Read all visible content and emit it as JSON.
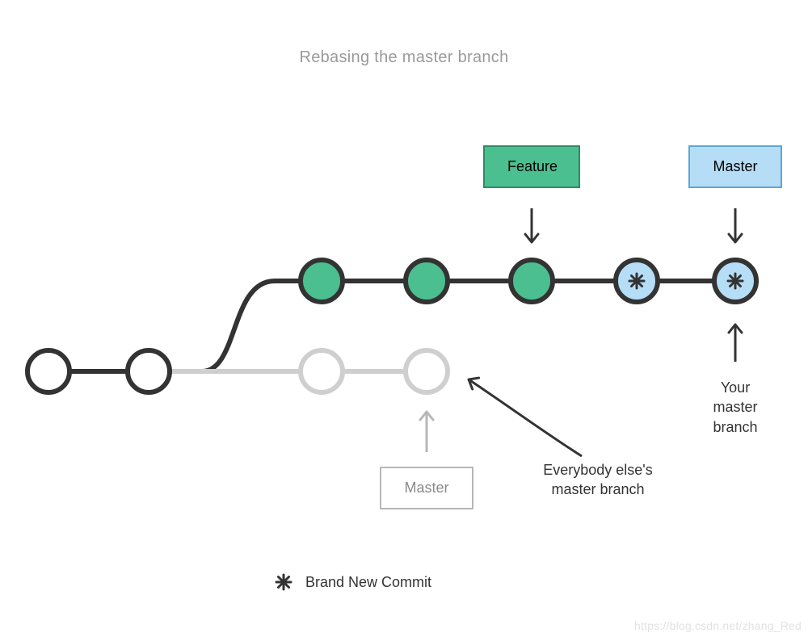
{
  "title": "Rebasing the master branch",
  "tags": {
    "feature": "Feature",
    "master_new": "Master",
    "master_old": "Master"
  },
  "annotations": {
    "your_master": "Your\nmaster\nbranch",
    "others_master": "Everybody else's\nmaster branch"
  },
  "legend": {
    "new_commit": "Brand New Commit"
  },
  "watermark": "https://blog.csdn.net/zhang_Red",
  "chart_data": {
    "type": "diagram",
    "description": "Git rebase of master onto feature branch tip",
    "top_row": [
      {
        "id": "f1",
        "kind": "feature",
        "color": "#4bbf8f"
      },
      {
        "id": "f2",
        "kind": "feature",
        "color": "#4bbf8f"
      },
      {
        "id": "f3",
        "kind": "feature",
        "color": "#4bbf8f",
        "tag": "Feature"
      },
      {
        "id": "m1_new",
        "kind": "new_commit",
        "color": "#b6ddf6",
        "star": true
      },
      {
        "id": "m2_new",
        "kind": "new_commit",
        "color": "#b6ddf6",
        "star": true,
        "tag": "Master (yours)"
      }
    ],
    "bottom_row": [
      {
        "id": "c1",
        "kind": "base",
        "color": "#ffffff"
      },
      {
        "id": "c2",
        "kind": "base",
        "color": "#ffffff"
      },
      {
        "id": "m1_old",
        "kind": "old_master",
        "color": "#ffffff",
        "ghost": true
      },
      {
        "id": "m2_old",
        "kind": "old_master",
        "color": "#ffffff",
        "ghost": true,
        "tag": "Master (everyone else)"
      }
    ],
    "edges": [
      [
        "c1",
        "c2"
      ],
      [
        "c2",
        "f1",
        "curve-up"
      ],
      [
        "f1",
        "f2"
      ],
      [
        "f2",
        "f3"
      ],
      [
        "f3",
        "m1_new"
      ],
      [
        "m1_new",
        "m2_new"
      ],
      [
        "c2",
        "m1_old",
        "ghost"
      ],
      [
        "m1_old",
        "m2_old",
        "ghost"
      ]
    ]
  }
}
